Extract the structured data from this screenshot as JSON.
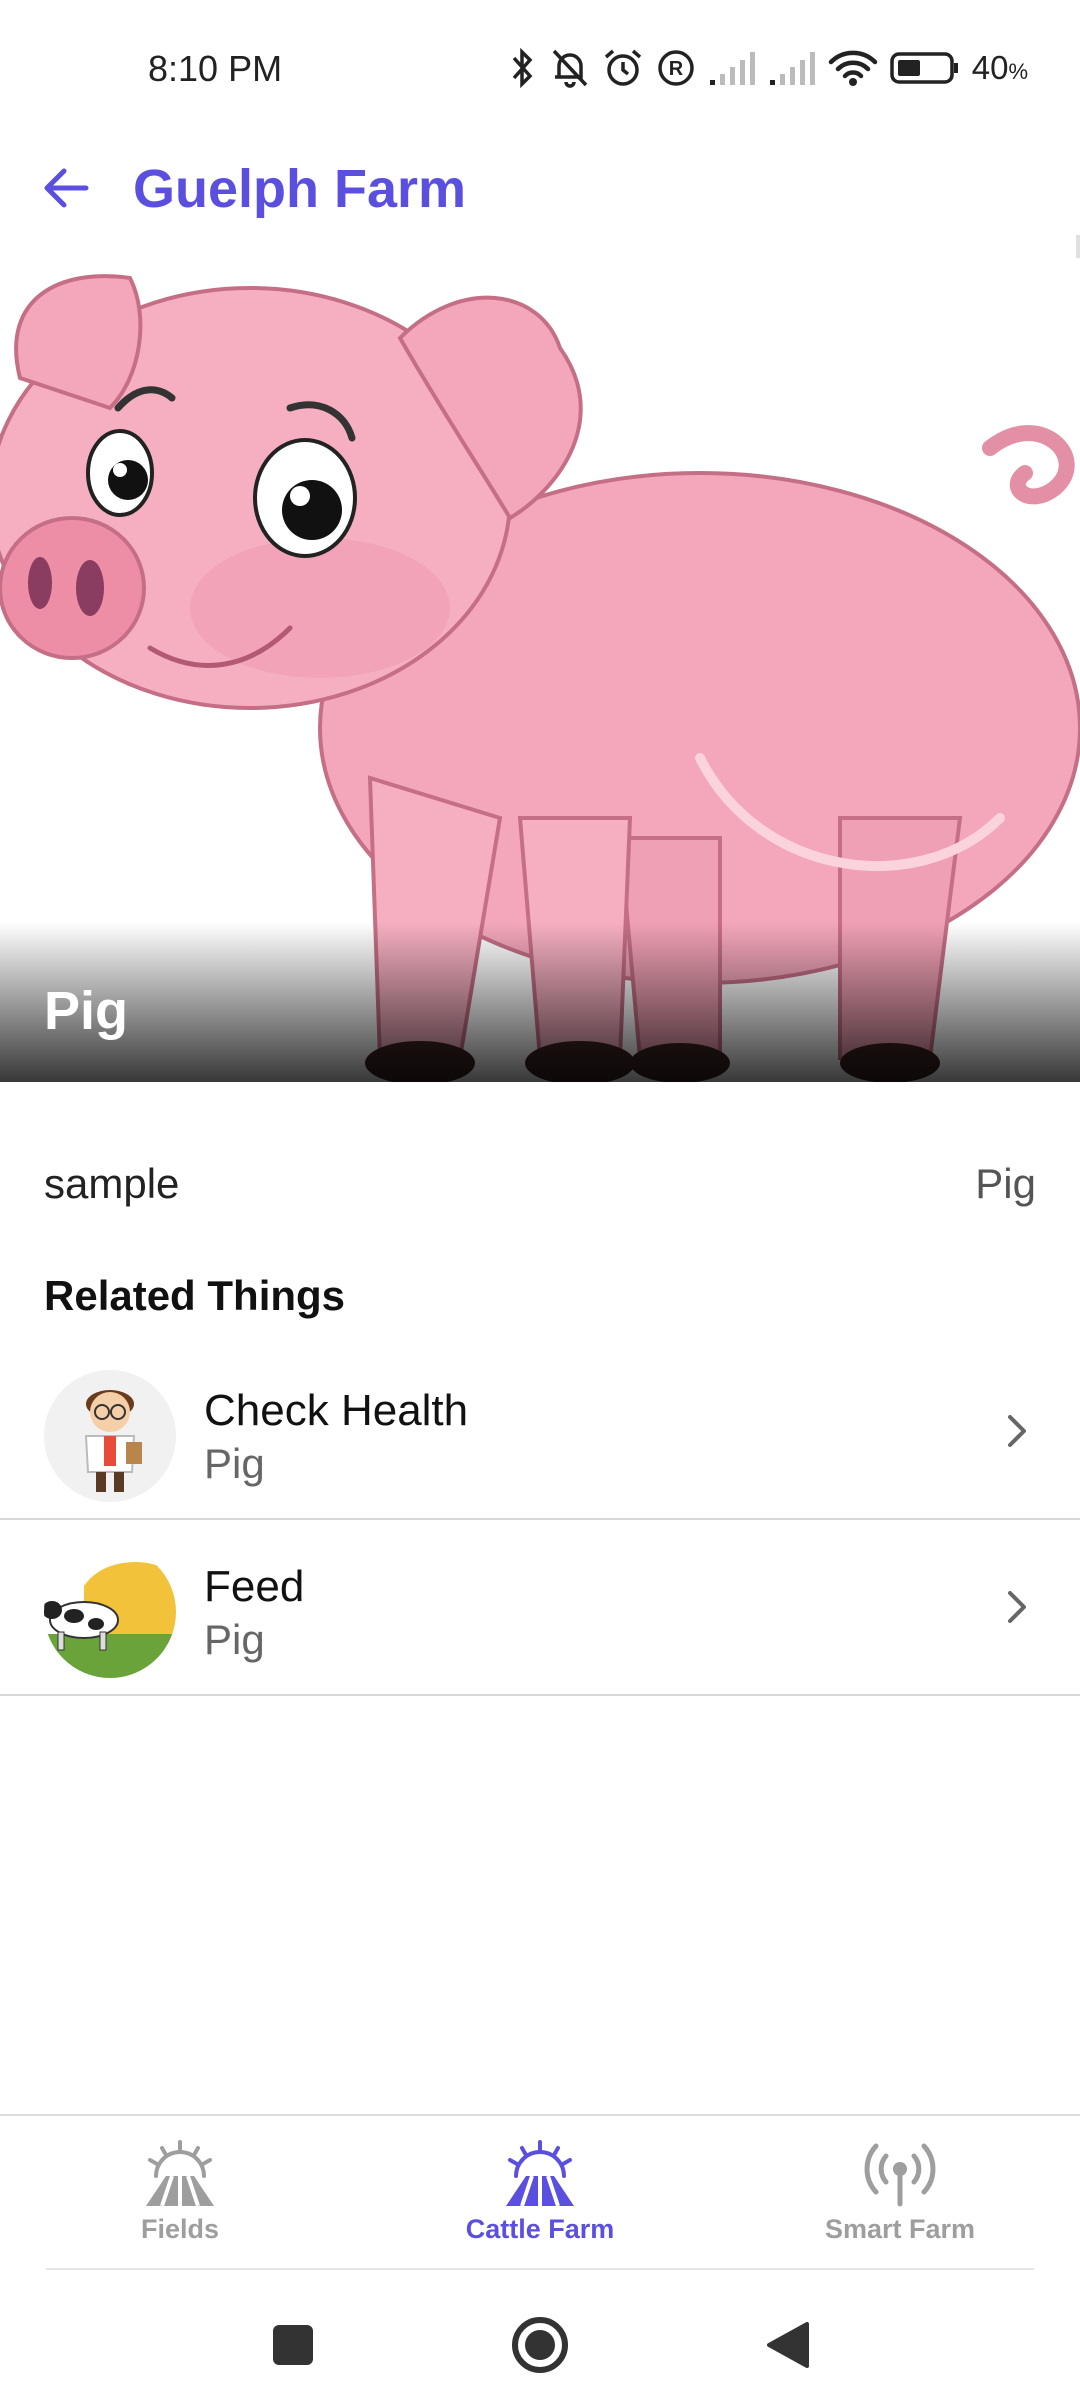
{
  "status_bar": {
    "time": "8:10 PM",
    "battery_percent": "40",
    "battery_unit": "%",
    "icons": [
      "bluetooth-icon",
      "bell-off-icon",
      "alarm-icon",
      "registered-icon",
      "signal-icon",
      "signal-icon",
      "wifi-icon",
      "battery-icon"
    ]
  },
  "app_bar": {
    "title": "Guelph Farm",
    "back_icon": "arrow-left-icon",
    "accent_color": "#5b4fe0"
  },
  "hero": {
    "title": "Pig",
    "image": "pig-illustration"
  },
  "details": {
    "key": "sample",
    "value": "Pig"
  },
  "related": {
    "section_title": "Related Things",
    "items": [
      {
        "title": "Check Health",
        "subtitle": "Pig",
        "thumb": "doctor-avatar"
      },
      {
        "title": "Feed",
        "subtitle": "Pig",
        "thumb": "cow-hay-image"
      }
    ]
  },
  "bottom_nav": {
    "items": [
      {
        "label": "Fields",
        "icon": "fields-icon",
        "active": false
      },
      {
        "label": "Cattle Farm",
        "icon": "cattle-farm-icon",
        "active": true
      },
      {
        "label": "Smart Farm",
        "icon": "antenna-icon",
        "active": false
      }
    ],
    "active_color": "#5b4fe0",
    "inactive_color": "#9e9e9e"
  },
  "system_nav": {
    "buttons": [
      "recents-button",
      "home-button",
      "back-button"
    ]
  }
}
